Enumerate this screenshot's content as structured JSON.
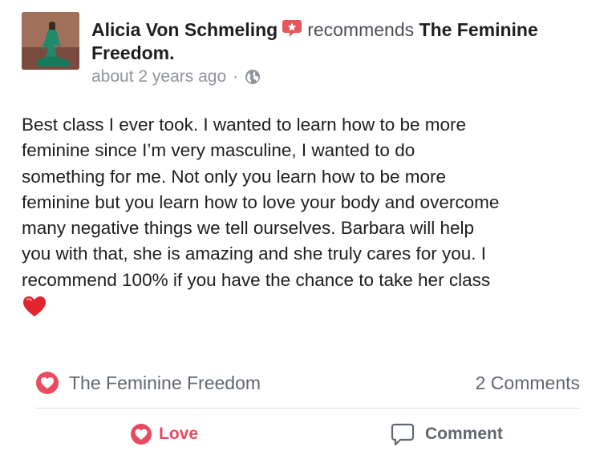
{
  "post": {
    "author": "Alicia Von Schmeling",
    "action": "recommends",
    "page_name_line1": "The Feminine",
    "page_name_line2": "Freedom.",
    "timestamp": "about 2 years ago",
    "separator": "·",
    "privacy_icon": "globe-icon",
    "body": "Best class I ever took. I wanted to learn how to be more\nfeminine since I’m very masculine, I wanted to do\nsomething for me. Not only you learn how to be more\nfeminine but you learn how to love your body and overcome\nmany negative things we tell ourselves. Barbara will help\nyou with that, she is amazing and she truly cares for you. I\nrecommend 100% if you have the chance to take her class",
    "emoji": "red-heart-icon"
  },
  "footer": {
    "page_name": "The Feminine Freedom",
    "comments": "2 Comments"
  },
  "actions": {
    "love_label": "Love",
    "comment_label": "Comment"
  },
  "colors": {
    "love_red": "#e8495e",
    "badge_red": "#e9555a",
    "muted_text": "#90949c",
    "secondary_text": "#616770"
  }
}
